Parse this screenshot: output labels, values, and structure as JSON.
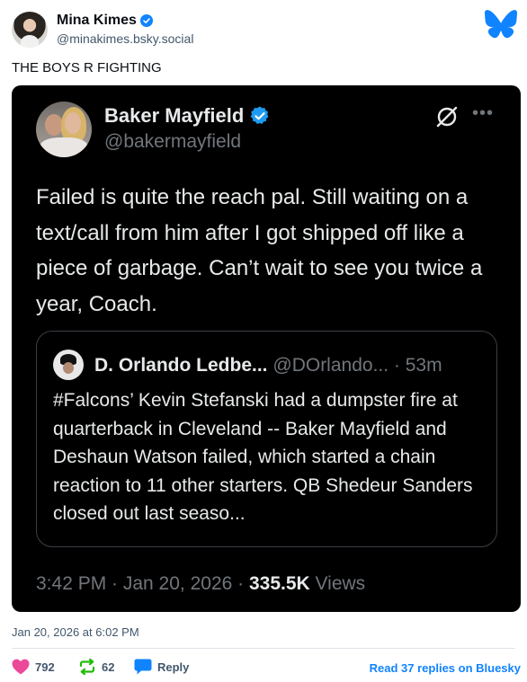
{
  "author": {
    "display_name": "Mina Kimes",
    "handle": "@minakimes.bsky.social",
    "verified": true
  },
  "post": {
    "text": "THE BOYS R FIGHTING",
    "timestamp": "Jan 20, 2026 at 6:02 PM"
  },
  "embed": {
    "name": "Baker Mayfield",
    "handle": "@bakermayfield",
    "text": "Failed is quite the reach pal. Still waiting on a text/call from him after I got shipped off like a piece of garbage. Can’t wait to see you twice a year, Coach.",
    "quote": {
      "name": "D. Orlando Ledbe...",
      "handle": "@DOrlando...",
      "time": "· 53m",
      "text": "#Falcons’ Kevin Stefanski had a dumpster fire at quarterback in Cleveland -- Baker Mayfield and Deshaun Watson failed, which started a chain reaction to 11 other starters. QB Shedeur Sanders closed out last seaso..."
    },
    "meta_time": "3:42 PM · Jan 20, 2026 · ",
    "views_count": "335.5K",
    "views_label": " Views"
  },
  "actions": {
    "likes": "792",
    "reposts": "62",
    "reply_label": "Reply",
    "read_replies": "Read 37 replies on Bluesky"
  },
  "colors": {
    "bluesky_blue": "#1083fe",
    "like_pink": "#ec4899",
    "repost_green": "#20bc07",
    "twitter_verified": "#1d9bf0"
  },
  "icons": [
    "verified-badge-icon",
    "bluesky-butterfly-icon",
    "grok-icon",
    "more-options-icon",
    "heart-icon",
    "repost-icon",
    "reply-icon"
  ]
}
